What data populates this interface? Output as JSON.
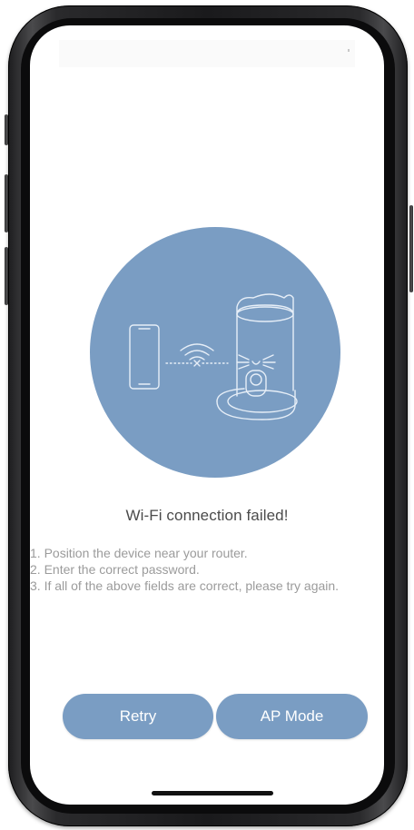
{
  "screen": {
    "title": "Wi-Fi connection failed!",
    "tips": [
      "1. Position the device near your router.",
      "2. Enter the correct password.",
      "3. If all of the above fields are correct, please try again."
    ],
    "buttons": {
      "retry": "Retry",
      "ap_mode": "AP Mode"
    },
    "illustration": {
      "icons": [
        "phone-icon",
        "wifi-icon",
        "pet-feeder-icon"
      ],
      "status": "failed"
    }
  },
  "colors": {
    "accent": "#7a9dc3",
    "title_text": "#4b4b4b",
    "tip_text": "#9b9b9b",
    "button_text": "#ffffff"
  }
}
